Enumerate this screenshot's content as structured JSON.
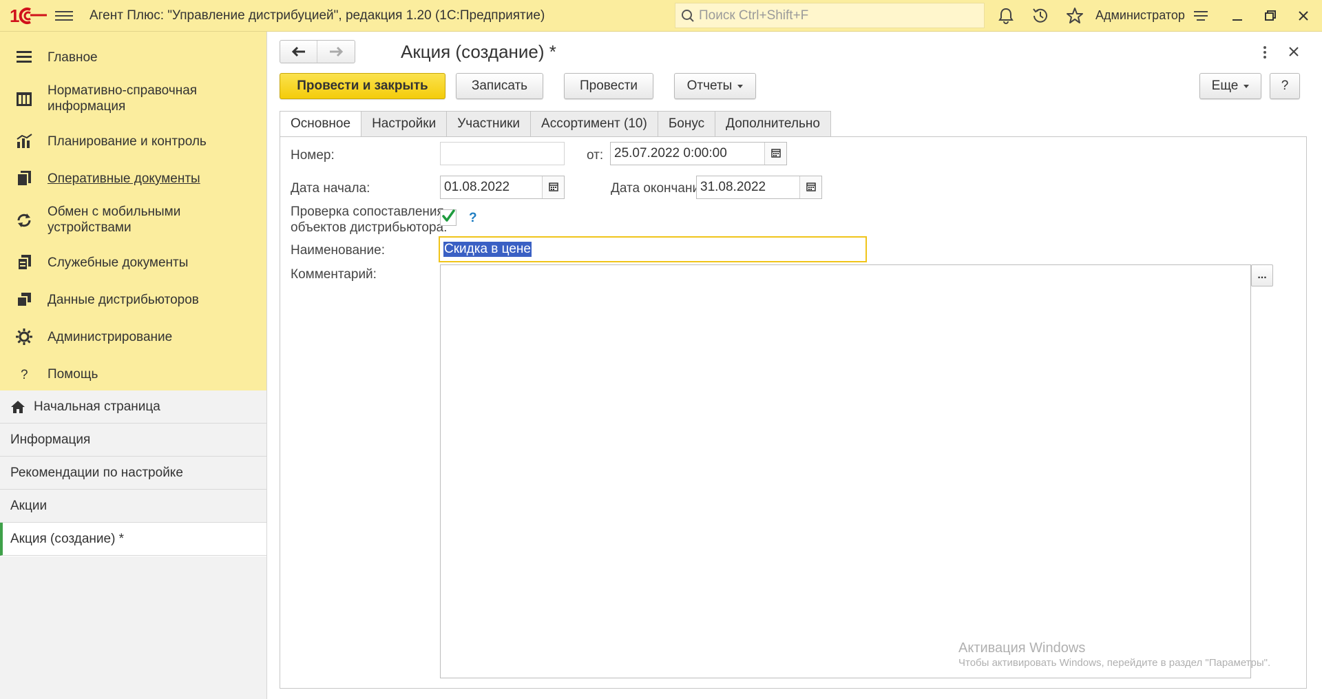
{
  "app": {
    "title": "Агент Плюс: \"Управление дистрибуцией\", редакция 1.20  (1С:Предприятие)",
    "search_placeholder": "Поиск Ctrl+Shift+F",
    "user": "Администратор",
    "accent_color": "#fbed9e"
  },
  "sidebar": {
    "sections": [
      {
        "label": "Главное",
        "icon": "menu-lines-icon"
      },
      {
        "label": "Нормативно-справочная информация",
        "icon": "grid-book-icon"
      },
      {
        "label": "Планирование и контроль",
        "icon": "bar-chart-icon"
      },
      {
        "label": "Оперативные документы",
        "icon": "documents-icon"
      },
      {
        "label": "Обмен с мобильными устройствами",
        "icon": "sync-icon"
      },
      {
        "label": "Служебные документы",
        "icon": "service-docs-icon"
      },
      {
        "label": "Данные дистрибьюторов",
        "icon": "distributor-data-icon"
      },
      {
        "label": "Администрирование",
        "icon": "gear-icon"
      },
      {
        "label": "Помощь",
        "icon": "question-icon"
      }
    ],
    "open_windows": [
      {
        "label": "Начальная страница"
      },
      {
        "label": "Информация"
      },
      {
        "label": "Рекомендации по настройке"
      },
      {
        "label": "Акции"
      },
      {
        "label": "Акция (создание) *"
      }
    ]
  },
  "form": {
    "title": "Акция (создание) *",
    "buttons": {
      "post_close": "Провести и закрыть",
      "save": "Записать",
      "post": "Провести",
      "reports": "Отчеты",
      "more": "Еще",
      "help": "?"
    },
    "tabs": [
      "Основное",
      "Настройки",
      "Участники",
      "Ассортимент (10)",
      "Бонус",
      "Дополнительно"
    ],
    "fields": {
      "number_label": "Номер:",
      "number_value": "",
      "from_label": "от:",
      "from_value": "25.07.2022  0:00:00",
      "start_label": "Дата начала:",
      "start_value": "01.08.2022",
      "end_label": "Дата окончания:",
      "end_value": "31.08.2022",
      "check_label_1": "Проверка сопоставления",
      "check_label_2": "объектов дистрибьютора:",
      "check_value": true,
      "check_help": "?",
      "name_label": "Наименование:",
      "name_value": "Скидка в цене",
      "comment_label": "Комментарий:",
      "comment_value": "",
      "comment_btn": "..."
    }
  },
  "watermark": {
    "title": "Активация Windows",
    "subtitle": "Чтобы активировать Windows, перейдите в раздел \"Параметры\"."
  }
}
